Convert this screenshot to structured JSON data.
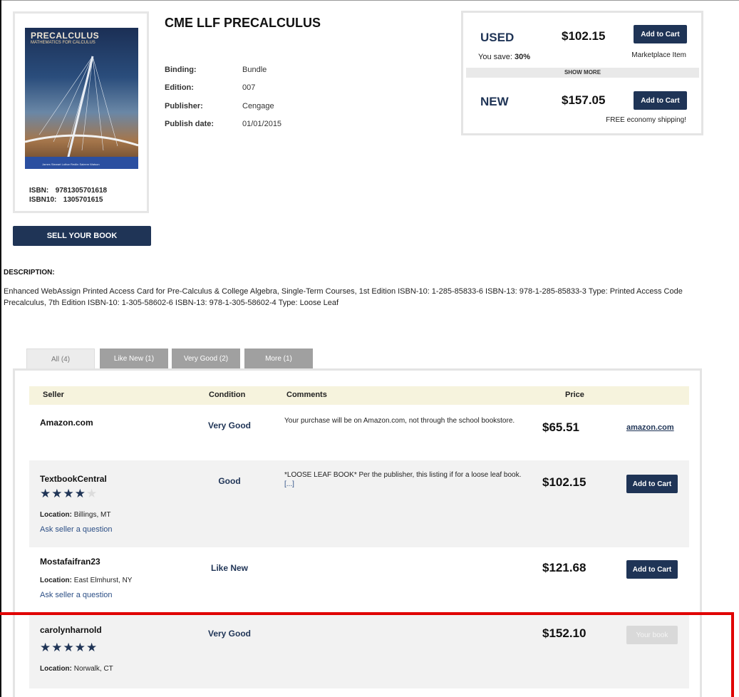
{
  "book": {
    "cover_title": "PRECALCULUS",
    "cover_subtitle": "MATHEMATICS FOR CALCULUS",
    "cover_authors": "James Stewart   Lothar Redlin   Saleem Watson",
    "title": "CME LLF PRECALCULUS",
    "isbn_label": "ISBN:",
    "isbn": "9781305701618",
    "isbn10_label": "ISBN10:",
    "isbn10": "1305701615",
    "sell_button": "SELL YOUR BOOK",
    "details": [
      {
        "label": "Binding:",
        "value": "Bundle"
      },
      {
        "label": "Edition:",
        "value": "007"
      },
      {
        "label": "Publisher:",
        "value": "Cengage"
      },
      {
        "label": "Publish date:",
        "value": "01/01/2015"
      }
    ]
  },
  "price_box": {
    "used": {
      "condition": "USED",
      "price": "$102.15",
      "button": "Add to Cart",
      "save_label": "You save:",
      "save_pct": "30%",
      "note": "Marketplace Item"
    },
    "show_more": "SHOW MORE",
    "new": {
      "condition": "NEW",
      "price": "$157.05",
      "button": "Add to Cart",
      "note": "FREE economy shipping!"
    }
  },
  "description": {
    "heading": "DESCRIPTION:",
    "text": "Enhanced WebAssign Printed Access Card for Pre-Calculus & College Algebra, Single-Term Courses, 1st Edition ISBN-10: 1-285-85833-6 ISBN-13: 978-1-285-85833-3 Type: Printed Access Code Precalculus, 7th Edition ISBN-10: 1-305-58602-6 ISBN-13: 978-1-305-58602-4 Type: Loose Leaf"
  },
  "tabs": [
    "All (4)",
    "Like New (1)",
    "Very Good (2)",
    "More (1)"
  ],
  "table": {
    "headers": {
      "seller": "Seller",
      "condition": "Condition",
      "comments": "Comments",
      "price": "Price"
    },
    "rows": [
      {
        "seller": "Amazon.com",
        "condition": "Very Good",
        "comment": "Your purchase will be on Amazon.com, not through the school bookstore.",
        "price": "$65.51",
        "action": "amazon.com"
      },
      {
        "seller": "TextbookCentral",
        "stars_on": "★★★★",
        "stars_off": "★",
        "location_label": "Location:",
        "location": "Billings, MT",
        "ask": "Ask seller a question",
        "condition": "Good",
        "comment": "*LOOSE LEAF BOOK* Per the publisher, this listing if for a loose leaf book.",
        "comment_more": "[...]",
        "price": "$102.15",
        "action": "Add to Cart"
      },
      {
        "seller": "Mostafaifran23",
        "location_label": "Location:",
        "location": "East Elmhurst, NY",
        "ask": "Ask seller a question",
        "condition": "Like New",
        "price": "$121.68",
        "action": "Add to Cart"
      },
      {
        "seller": "carolynharnold",
        "stars_on": "★★★★★",
        "location_label": "Location:",
        "location": "Norwalk, CT",
        "condition": "Very Good",
        "price": "$152.10",
        "action": "Your book"
      }
    ]
  },
  "colors": {
    "navy": "#1f3456",
    "link": "#2c4f86",
    "header_bg": "#f6f3dd",
    "highlight": "#e00000"
  }
}
